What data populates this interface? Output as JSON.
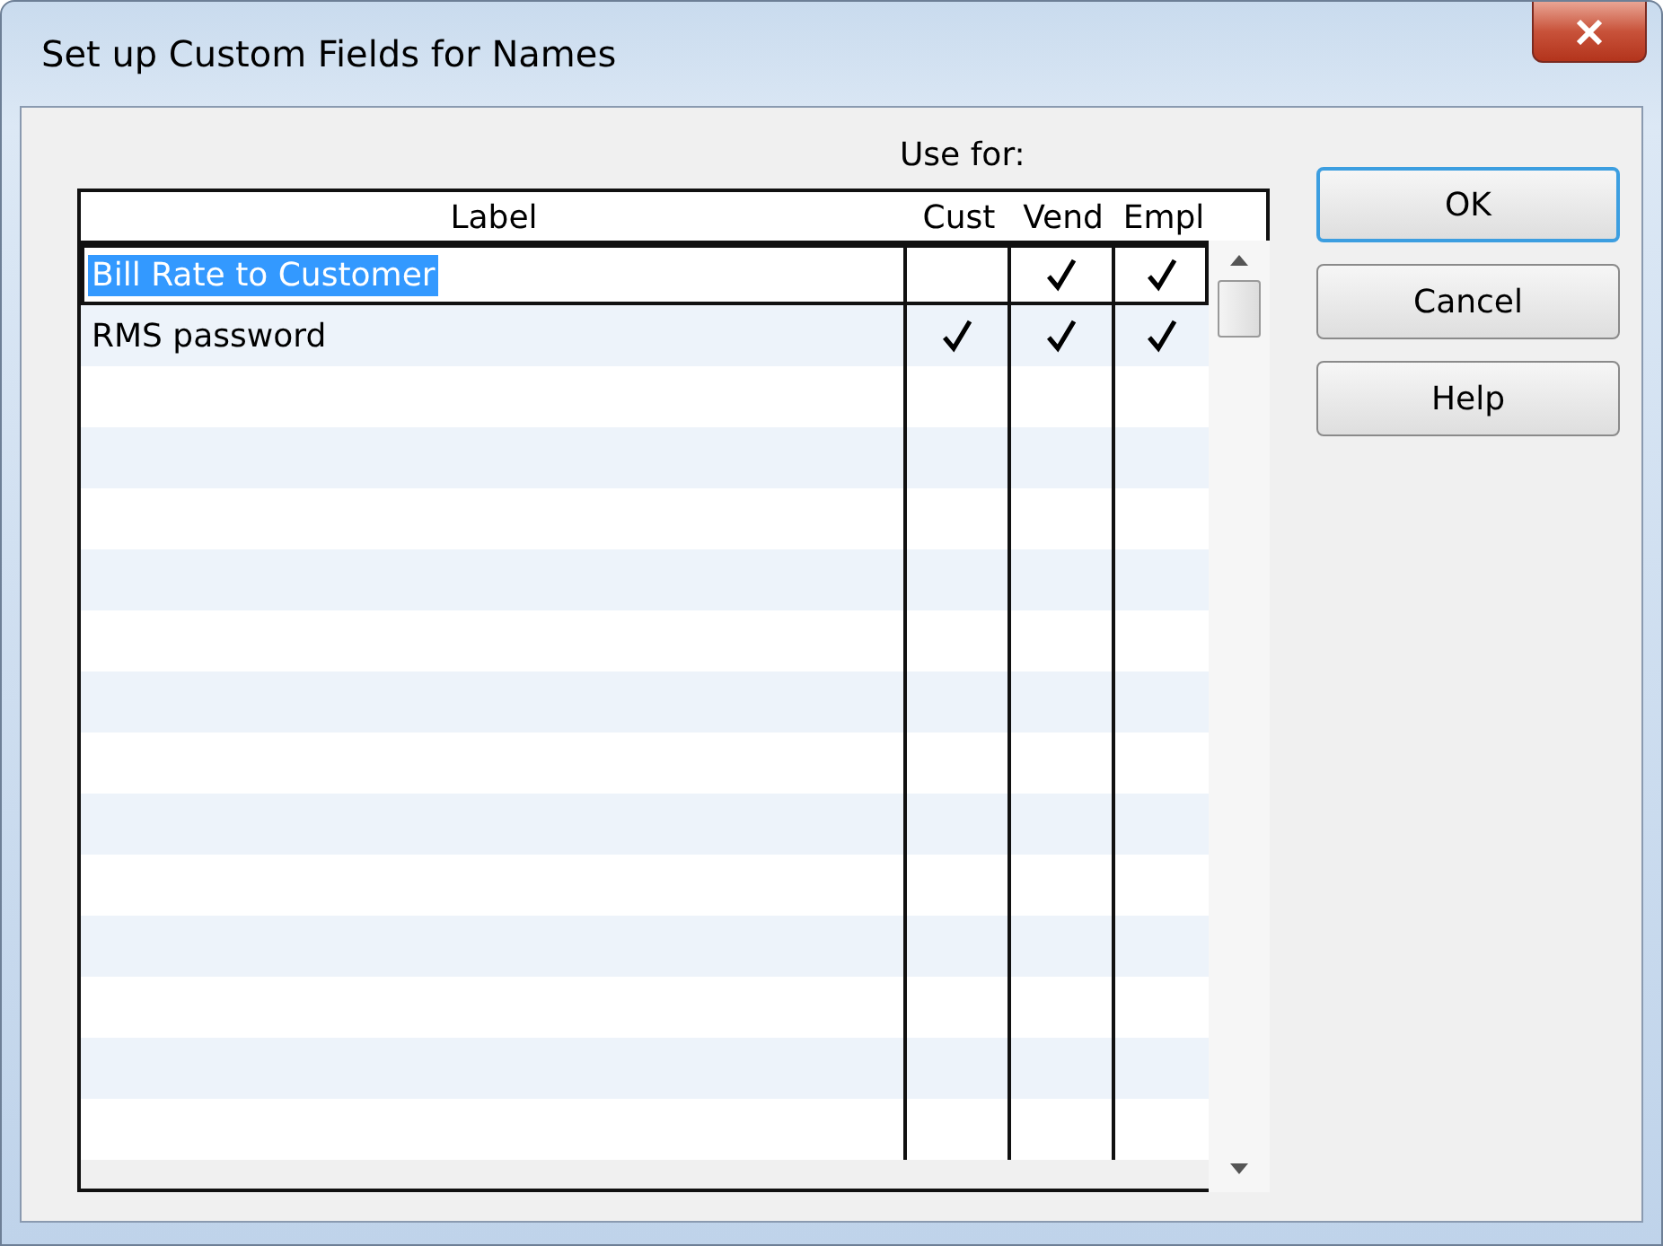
{
  "window": {
    "title": "Set up Custom Fields for Names"
  },
  "use_for_label": "Use for:",
  "table": {
    "columns": [
      "Label",
      "Cust",
      "Vend",
      "Empl"
    ],
    "rows": [
      {
        "label": "Bill Rate to Customer",
        "selected": true,
        "cust": false,
        "vend": true,
        "empl": true
      },
      {
        "label": "RMS password",
        "selected": false,
        "cust": true,
        "vend": true,
        "empl": true
      }
    ]
  },
  "buttons": [
    {
      "label": "OK",
      "default": true
    },
    {
      "label": "Cancel",
      "default": false
    },
    {
      "label": "Help",
      "default": false
    }
  ]
}
